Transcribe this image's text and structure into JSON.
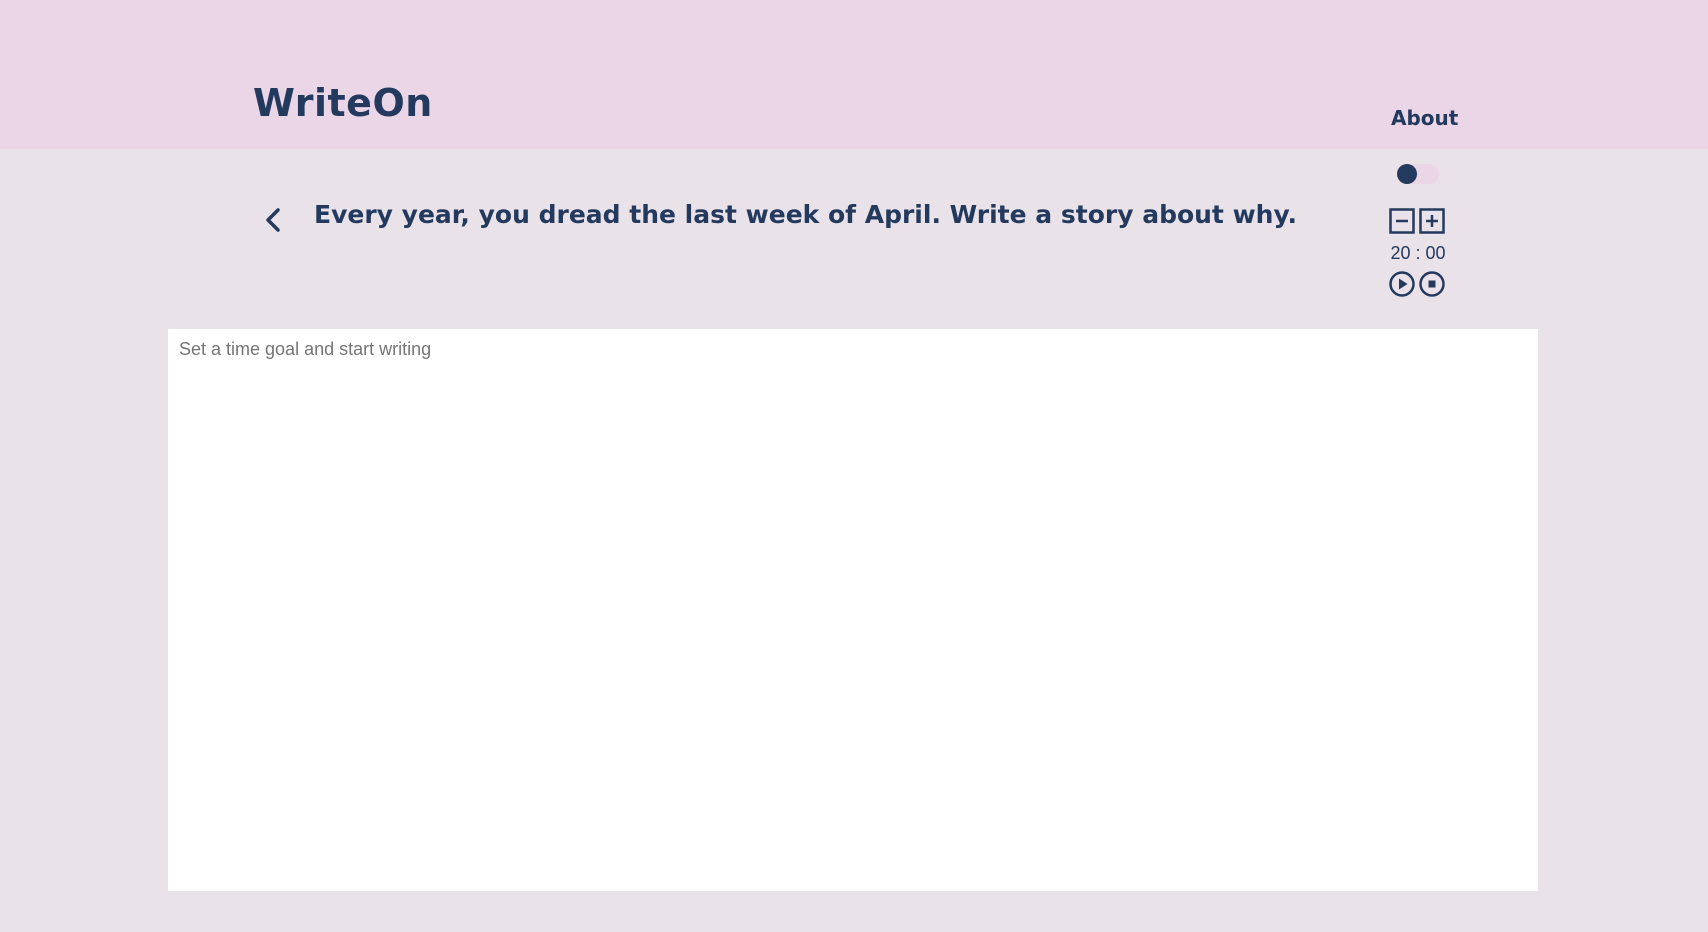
{
  "header": {
    "logo": "WriteOn",
    "nav_about": "About"
  },
  "theme_toggle": {
    "state": "off"
  },
  "prompt": {
    "text": "Every year, you dread the last week of April. Write a story about why."
  },
  "timer": {
    "display": "20 : 00",
    "icons": [
      "minus-square-icon",
      "plus-square-icon",
      "play-circle-icon",
      "stop-circle-icon"
    ]
  },
  "editor": {
    "placeholder": "Set a time goal and start writing",
    "value": ""
  },
  "colors": {
    "header_bg": "#ead6e6",
    "page_bg": "#e9e2e8",
    "text_primary": "#233a5e",
    "editor_bg": "#ffffff"
  }
}
